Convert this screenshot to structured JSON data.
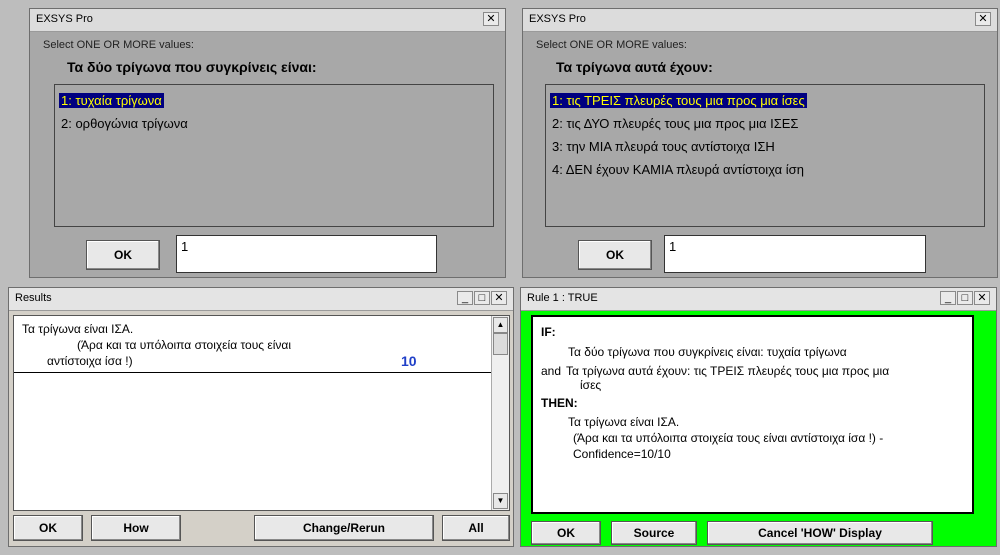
{
  "dialog1": {
    "title": "EXSYS Pro",
    "subtitle": "Select ONE OR MORE values:",
    "heading": "Τα δύο τρίγωνα που συγκρίνεις είναι:",
    "items": [
      "1:  τυχαία τρίγωνα",
      "2:  ορθογώνια τρίγωνα"
    ],
    "ok": "OK",
    "input": "1",
    "close": "✕"
  },
  "dialog2": {
    "title": "EXSYS Pro",
    "subtitle": "Select ONE OR MORE values:",
    "heading": "Τα τρίγωνα αυτά έχουν:",
    "items": [
      "1:  τις ΤΡΕΙΣ πλευρές τους μια προς μια ίσες",
      "2:  τις ΔΥΟ πλευρές τους μια προς μια ΙΣΕΣ",
      "3:  την ΜΙΑ πλευρά τους αντίστοιχα ΙΣΗ",
      "4:  ΔΕΝ έχουν ΚΑΜΙΑ πλευρά αντίστοιχα ίση"
    ],
    "ok": "OK",
    "input": "1",
    "close": "✕"
  },
  "results": {
    "title": "Results",
    "line1": "Τα τρίγωνα είναι ΙΣΑ.",
    "line2": "(Άρα και τα υπόλοιπα στοιχεία τους είναι",
    "line3": "αντίστοιχα ίσα !)",
    "score": "10",
    "buttons": {
      "ok": "OK",
      "how": "How",
      "change": "Change/Rerun",
      "all": "All"
    },
    "min": "_",
    "max": "□",
    "close": "✕"
  },
  "rule": {
    "title": "Rule 1 : TRUE",
    "if_label": "IF:",
    "cond1": "Τα δύο τρίγωνα που συγκρίνεις είναι: τυχαία τρίγωνα",
    "and_label": "and",
    "cond2a": "Τα τρίγωνα αυτά έχουν: τις ΤΡΕΙΣ πλευρές τους μια προς μια",
    "cond2b": "ίσες",
    "then_label": "THEN:",
    "res1": "Τα τρίγωνα είναι ΙΣΑ.",
    "res2": "(Άρα και τα υπόλοιπα στοιχεία τους είναι αντίστοιχα ίσα !) -",
    "res3": "Confidence=10/10",
    "buttons": {
      "ok": "OK",
      "source": "Source",
      "cancel": "Cancel 'HOW' Display"
    },
    "min": "_",
    "max": "□",
    "close": "✕",
    "bg_color": "#00ff00"
  }
}
